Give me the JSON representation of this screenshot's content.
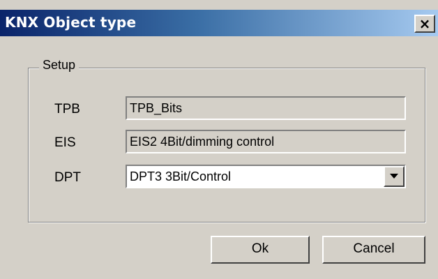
{
  "window": {
    "title": "KNX Object type",
    "close_glyph": "×"
  },
  "setup": {
    "legend": "Setup",
    "tpb": {
      "label": "TPB",
      "value": "TPB_Bits"
    },
    "eis": {
      "label": "EIS",
      "value": "EIS2 4Bit/dimming control"
    },
    "dpt": {
      "label": "DPT",
      "value": "DPT3 3Bit/Control"
    }
  },
  "buttons": {
    "ok": "Ok",
    "cancel": "Cancel"
  },
  "icons": {
    "close": "close-icon",
    "dropdown": "chevron-down-icon"
  }
}
